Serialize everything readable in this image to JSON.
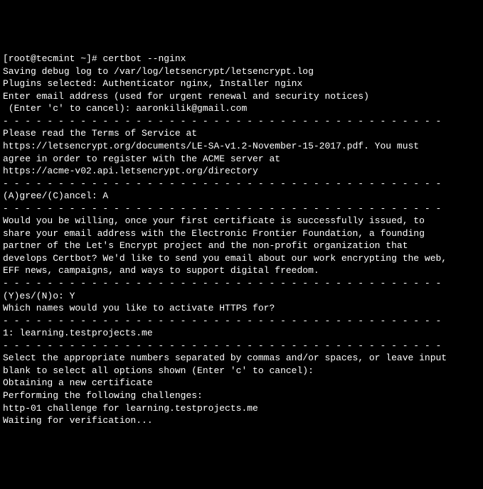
{
  "terminal": {
    "prompt": "[root@tecmint ~]# ",
    "command": "certbot --nginx",
    "lines": [
      "Saving debug log to /var/log/letsencrypt/letsencrypt.log",
      "Plugins selected: Authenticator nginx, Installer nginx",
      "Enter email address (used for urgent renewal and security notices)",
      " (Enter 'c' to cancel): aaronkilik@gmail.com",
      "",
      "- - - - - - - - - - - - - - - - - - - - - - - - - - - - - - - - - - - - - - - -",
      "Please read the Terms of Service at",
      "https://letsencrypt.org/documents/LE-SA-v1.2-November-15-2017.pdf. You must",
      "agree in order to register with the ACME server at",
      "https://acme-v02.api.letsencrypt.org/directory",
      "- - - - - - - - - - - - - - - - - - - - - - - - - - - - - - - - - - - - - - - -",
      "(A)gree/(C)ancel: A",
      "",
      "- - - - - - - - - - - - - - - - - - - - - - - - - - - - - - - - - - - - - - - -",
      "Would you be willing, once your first certificate is successfully issued, to",
      "share your email address with the Electronic Frontier Foundation, a founding",
      "partner of the Let's Encrypt project and the non-profit organization that",
      "develops Certbot? We'd like to send you email about our work encrypting the web,",
      "EFF news, campaigns, and ways to support digital freedom.",
      "- - - - - - - - - - - - - - - - - - - - - - - - - - - - - - - - - - - - - - - -",
      "(Y)es/(N)o: Y",
      "",
      "Which names would you like to activate HTTPS for?",
      "- - - - - - - - - - - - - - - - - - - - - - - - - - - - - - - - - - - - - - - -",
      "1: learning.testprojects.me",
      "- - - - - - - - - - - - - - - - - - - - - - - - - - - - - - - - - - - - - - - -",
      "Select the appropriate numbers separated by commas and/or spaces, or leave input",
      "blank to select all options shown (Enter 'c' to cancel):",
      "Obtaining a new certificate",
      "Performing the following challenges:",
      "http-01 challenge for learning.testprojects.me",
      "Waiting for verification..."
    ]
  }
}
